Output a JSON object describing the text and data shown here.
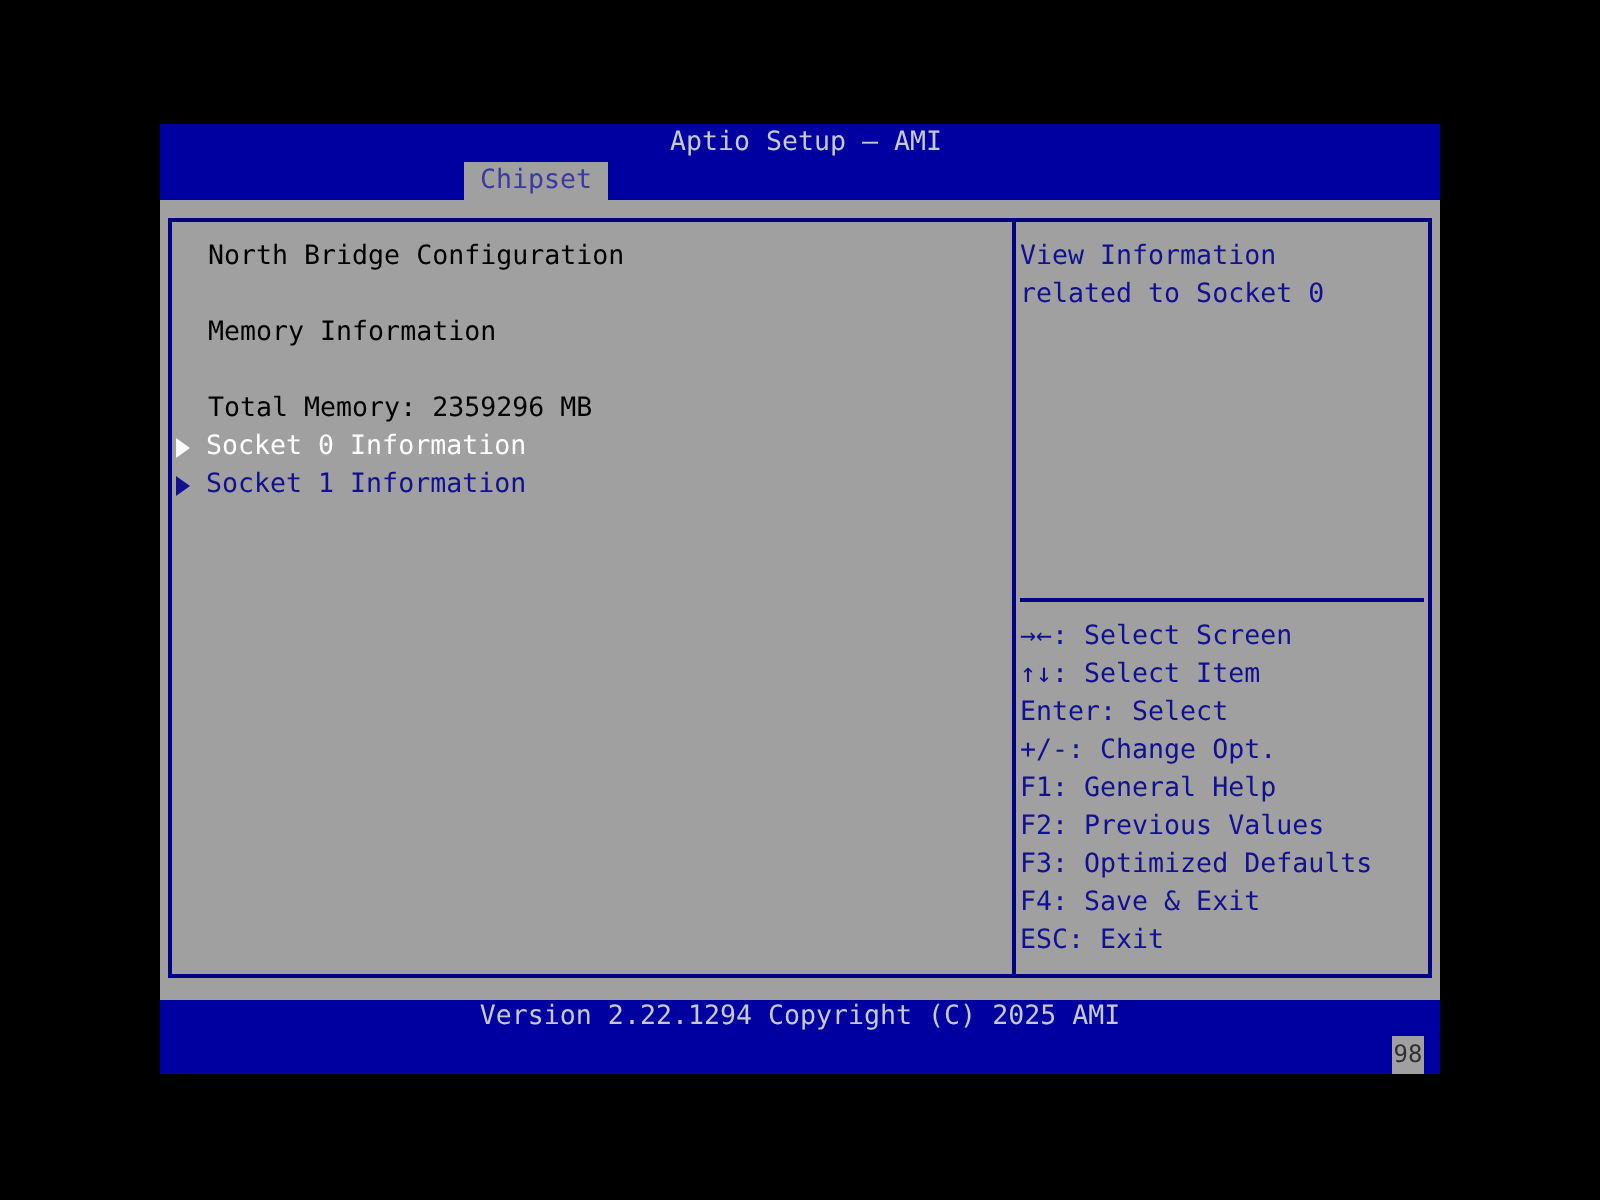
{
  "window": {
    "title": "Aptio Setup – AMI"
  },
  "tabs": [
    {
      "label": "Chipset",
      "selected": true
    }
  ],
  "menu": {
    "sections": [
      {
        "items": [
          {
            "kind": "label",
            "text": "North Bridge Configuration",
            "selected": false
          }
        ]
      },
      {
        "items": [
          {
            "kind": "label",
            "text": "Memory Information",
            "selected": false
          }
        ]
      },
      {
        "items": [
          {
            "kind": "label",
            "text": "Total Memory: 2359296 MB",
            "selected": false
          },
          {
            "kind": "submenu",
            "text": "Socket 0 Information",
            "selected": true
          },
          {
            "kind": "submenu",
            "text": "Socket 1 Information",
            "selected": false
          }
        ]
      }
    ]
  },
  "help": {
    "text": "View Information related to Socket 0",
    "keys": [
      "→←: Select Screen",
      "↑↓: Select Item",
      "Enter: Select",
      "+/-: Change Opt.",
      "F1: General Help",
      "F2: Previous Values",
      "F3: Optimized Defaults",
      "F4: Save & Exit",
      "ESC: Exit"
    ]
  },
  "footer": {
    "version": "Version 2.22.1294 Copyright (C) 2025 AMI",
    "code": "98"
  }
}
